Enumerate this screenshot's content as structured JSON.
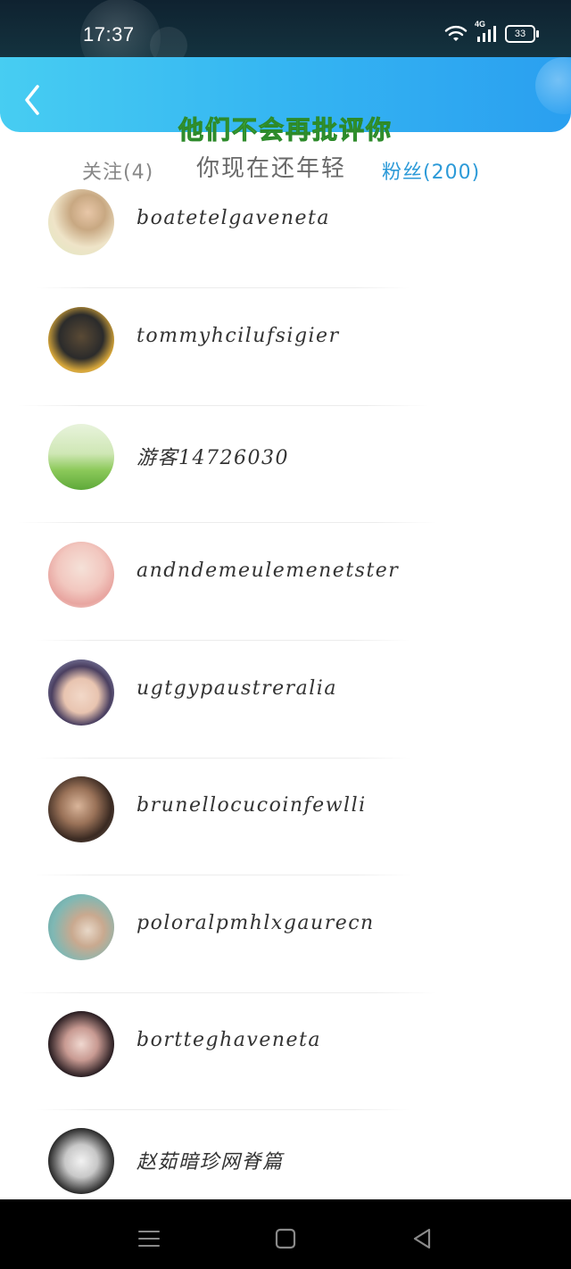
{
  "status_bar": {
    "time": "17:37",
    "network": "4G",
    "battery": "33",
    "icons": [
      "wifi-icon",
      "signal-icon",
      "battery-icon"
    ]
  },
  "header": {
    "back_icon": "chevron-left-icon",
    "banner_line1": "他们不会再批评你",
    "banner_line2": "你现在还年轻"
  },
  "tabs": {
    "following": "关注(4)",
    "fans": "粉丝(200)",
    "active": "fans"
  },
  "fans": [
    {
      "name": "boatetelgaveneta"
    },
    {
      "name": "tommyhcilufsigier"
    },
    {
      "name": "游客14726030"
    },
    {
      "name": "andndemeulemenetster"
    },
    {
      "name": "ugtgypaustreralia"
    },
    {
      "name": "brunellocucoinfewlli"
    },
    {
      "name": "poloralpmhlxgaurecn"
    },
    {
      "name": "bortteghaveneta"
    },
    {
      "name": "赵茹暗珍网脊篇"
    }
  ],
  "nav_bar": {
    "icons": [
      "menu-icon",
      "home-icon",
      "back-triangle-icon"
    ]
  },
  "colors": {
    "header_start": "#47cdf2",
    "header_end": "#2a9ff0",
    "active_tab": "#2c9ad8",
    "inactive_tab": "#888888",
    "banner_green": "#55d64f"
  }
}
